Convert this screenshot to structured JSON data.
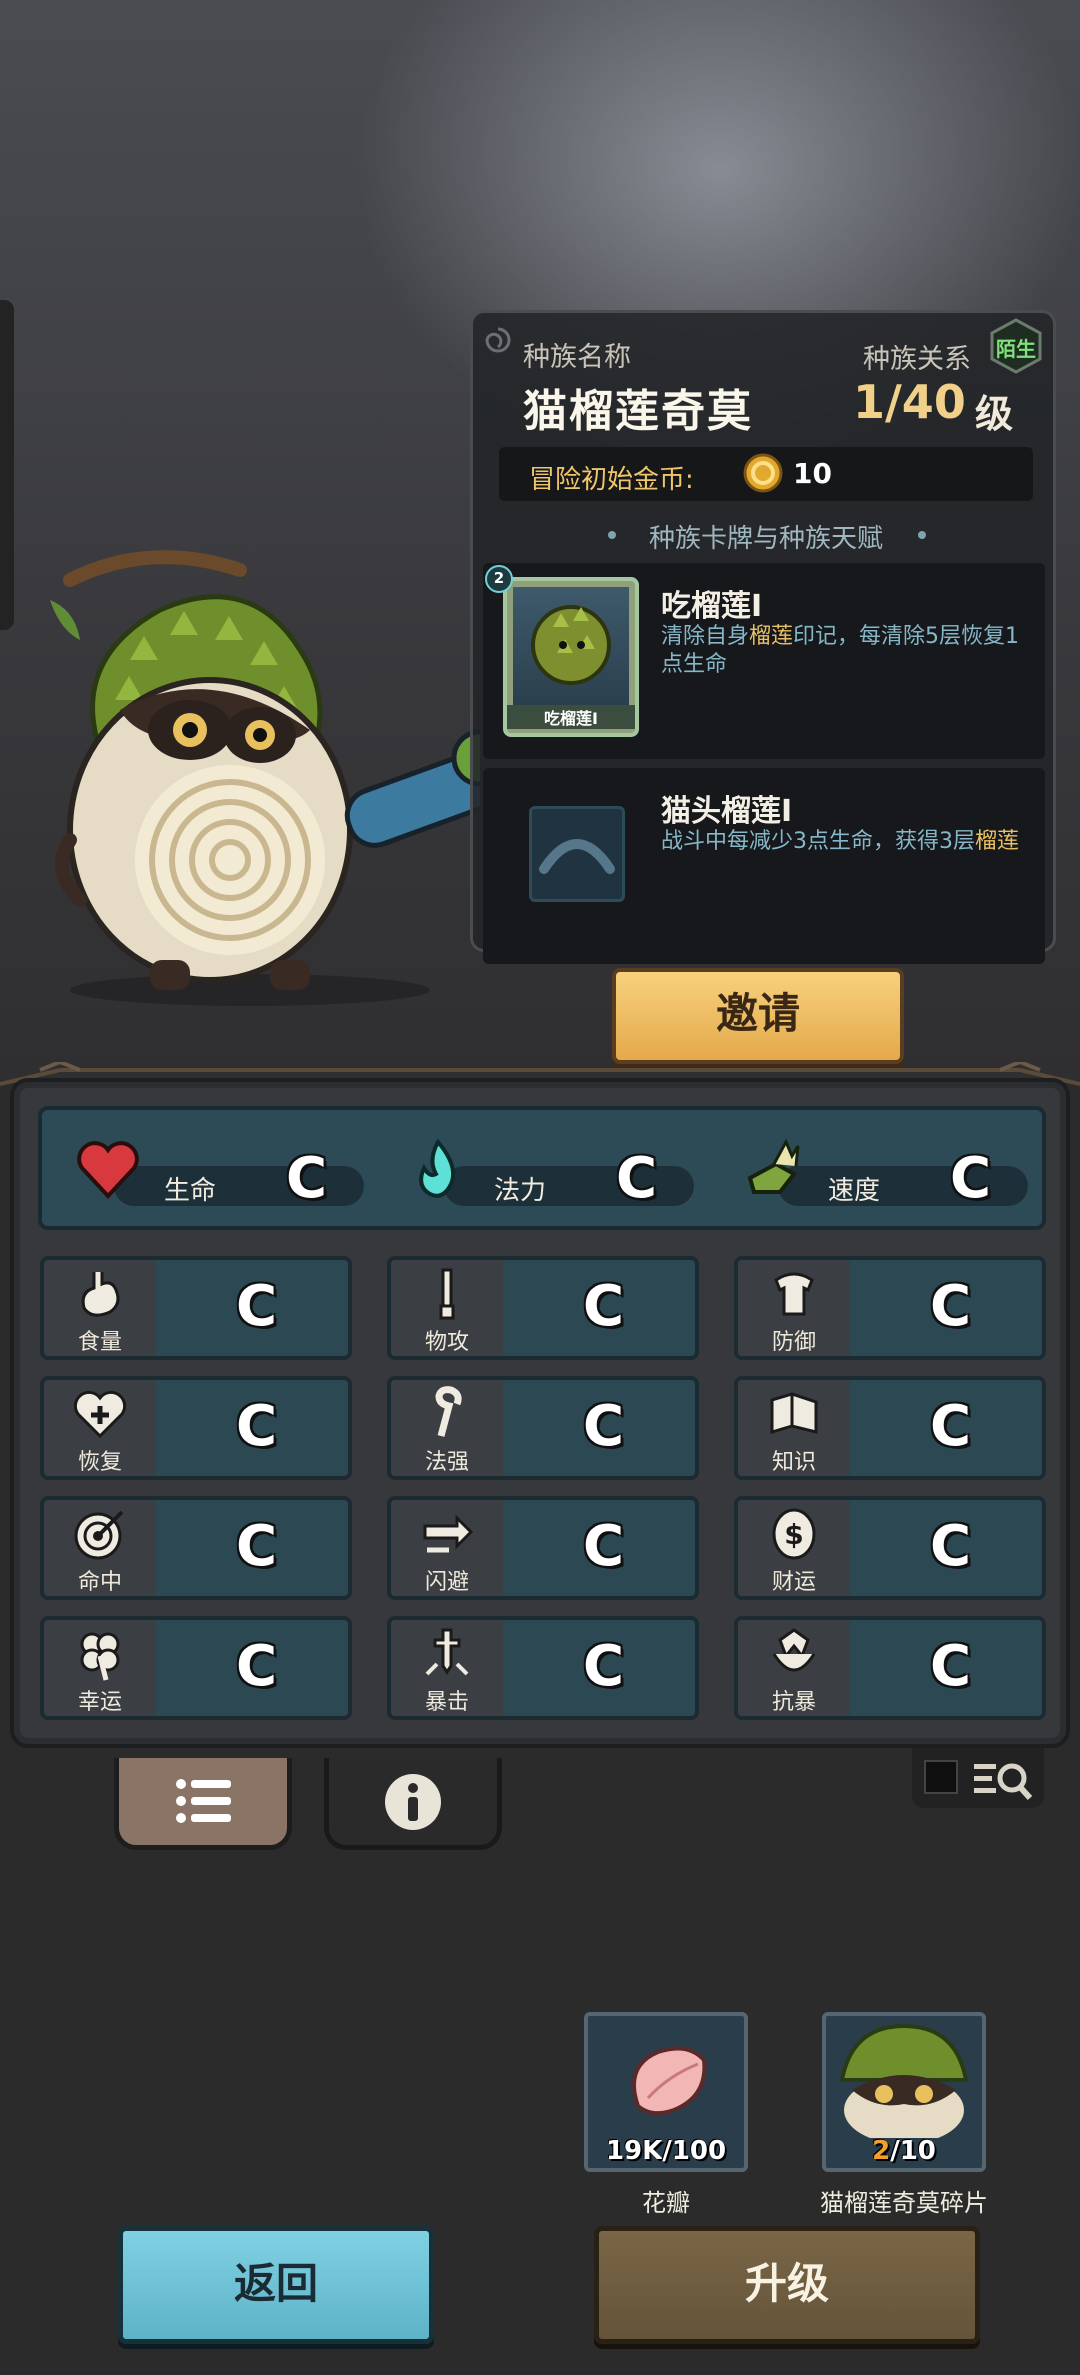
{
  "race_panel": {
    "name_label": "种族名称",
    "name": "猫榴莲奇莫",
    "relation_label": "种族关系",
    "relation_badge": "陌生",
    "level": "1/40",
    "level_unit": "级",
    "gold_label": "冒险初始金币:",
    "gold_value": "10",
    "section_title": "种族卡牌与种族天赋"
  },
  "race_card": {
    "title": "吃榴莲Ⅰ",
    "desc_before": "清除自身",
    "desc_highlight": "榴莲",
    "desc_after": "印记，每清除5层恢复1点生命",
    "thumb_label": "吃榴莲Ⅰ",
    "cost": "2"
  },
  "race_talent": {
    "title": "猫头榴莲Ⅰ",
    "desc_before": "战斗中每减少3点生命，获得3层",
    "desc_highlight": "榴莲"
  },
  "invite_label": "邀请",
  "top_stats": [
    {
      "label": "生命",
      "grade": "C",
      "icon": "heart-icon"
    },
    {
      "label": "法力",
      "grade": "C",
      "icon": "flame-icon"
    },
    {
      "label": "速度",
      "grade": "C",
      "icon": "winged-boot-icon"
    }
  ],
  "stats": [
    {
      "label": "食量",
      "grade": "C",
      "icon": "stomach-icon"
    },
    {
      "label": "物攻",
      "grade": "C",
      "icon": "sword-icon"
    },
    {
      "label": "防御",
      "grade": "C",
      "icon": "armor-icon"
    },
    {
      "label": "恢复",
      "grade": "C",
      "icon": "heart-plus-icon"
    },
    {
      "label": "法强",
      "grade": "C",
      "icon": "staff-icon"
    },
    {
      "label": "知识",
      "grade": "C",
      "icon": "book-icon"
    },
    {
      "label": "命中",
      "grade": "C",
      "icon": "target-icon"
    },
    {
      "label": "闪避",
      "grade": "C",
      "icon": "dodge-arrow-icon"
    },
    {
      "label": "财运",
      "grade": "C",
      "icon": "coin-icon"
    },
    {
      "label": "幸运",
      "grade": "C",
      "icon": "clover-icon"
    },
    {
      "label": "暴击",
      "grade": "C",
      "icon": "crit-dagger-icon"
    },
    {
      "label": "抗暴",
      "grade": "C",
      "icon": "shield-crest-icon"
    }
  ],
  "resources": [
    {
      "name": "花瓣",
      "current": "19K",
      "required": "/100"
    },
    {
      "name": "猫榴莲奇莫碎片",
      "current": "2",
      "required": "/10"
    }
  ],
  "back_label": "返回",
  "upgrade_label": "升级",
  "colors": {
    "gold": "#f1d08a",
    "highlight": "#e9c063",
    "desc": "#86b7c9",
    "relation": "#7fe27a"
  }
}
